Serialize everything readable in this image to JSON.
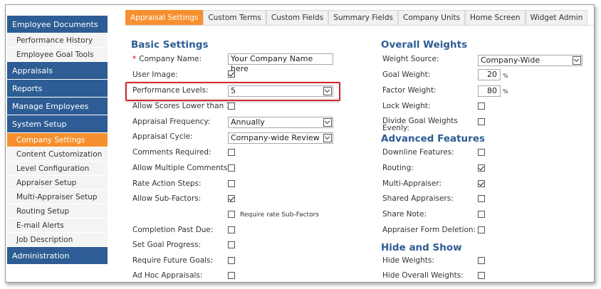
{
  "sidebar": {
    "items": [
      {
        "label": "Employee Documents",
        "type": "section"
      },
      {
        "label": "Performance History",
        "type": "sub"
      },
      {
        "label": "Employee Goal Tools",
        "type": "sub"
      },
      {
        "label": "Appraisals",
        "type": "section"
      },
      {
        "label": "Reports",
        "type": "section"
      },
      {
        "label": "Manage Employees",
        "type": "section"
      },
      {
        "label": "System Setup",
        "type": "section"
      },
      {
        "label": "Company Settings",
        "type": "sub",
        "active": true
      },
      {
        "label": "Content Customization",
        "type": "sub"
      },
      {
        "label": "Level Configuration",
        "type": "sub"
      },
      {
        "label": "Appraiser Setup",
        "type": "sub"
      },
      {
        "label": "Multi-Appraiser Setup",
        "type": "sub"
      },
      {
        "label": "Routing Setup",
        "type": "sub"
      },
      {
        "label": "E-mail Alerts",
        "type": "sub"
      },
      {
        "label": "Job Description",
        "type": "sub"
      },
      {
        "label": "Administration",
        "type": "section"
      }
    ]
  },
  "tabs": [
    {
      "label": "Appraisal Settings",
      "active": true
    },
    {
      "label": "Custom Terms"
    },
    {
      "label": "Custom Fields"
    },
    {
      "label": "Summary Fields"
    },
    {
      "label": "Company Units"
    },
    {
      "label": "Home Screen"
    },
    {
      "label": "Widget Admin"
    }
  ],
  "basic": {
    "heading": "Basic Settings",
    "required_mark": "*",
    "company_name_label": "Company Name:",
    "company_name_value": "Your Company Name here",
    "user_image_label": "User Image:",
    "performance_levels_label": "Performance Levels:",
    "performance_levels_value": "5",
    "allow_lower_label": "Allow Scores Lower than 1:",
    "frequency_label": "Appraisal Frequency:",
    "frequency_value": "Annually",
    "cycle_label": "Appraisal Cycle:",
    "cycle_value": "Company-wide Review",
    "comments_required_label": "Comments Required:",
    "multiple_comments_label": "Allow Multiple Comments:",
    "rate_action_label": "Rate Action Steps:",
    "sub_factors_label": "Allow Sub-Factors:",
    "require_sub_factors_label": "Require rate Sub-Factors",
    "completion_past_due_label": "Completion Past Due:",
    "set_goal_progress_label": "Set Goal Progress:",
    "require_future_goals_label": "Require Future Goals:",
    "ad_hoc_label": "Ad Hoc Appraisals:"
  },
  "weights": {
    "heading": "Overall Weights",
    "source_label": "Weight Source:",
    "source_value": "Company-Wide",
    "goal_weight_label": "Goal Weight:",
    "goal_weight_value": "20",
    "factor_weight_label": "Factor Weight:",
    "factor_weight_value": "80",
    "percent": "%",
    "lock_weight_label": "Lock Weight:",
    "divide_label": "Divide Goal Weights Evenly:"
  },
  "advanced": {
    "heading": "Advanced Features",
    "downline_label": "Downline Features:",
    "routing_label": "Routing:",
    "multi_appraiser_label": "Multi-Appraiser:",
    "shared_label": "Shared Appraisers:",
    "share_note_label": "Share Note:",
    "form_deletion_label": "Appraiser Form Deletion:"
  },
  "hide": {
    "heading": "Hide and Show",
    "hide_weights_label": "Hide Weights:",
    "hide_overall_label": "Hide Overall Weights:"
  },
  "colors": {
    "accent": "#f6902f",
    "nav": "#2d5d94",
    "highlight": "#d42a2a"
  }
}
